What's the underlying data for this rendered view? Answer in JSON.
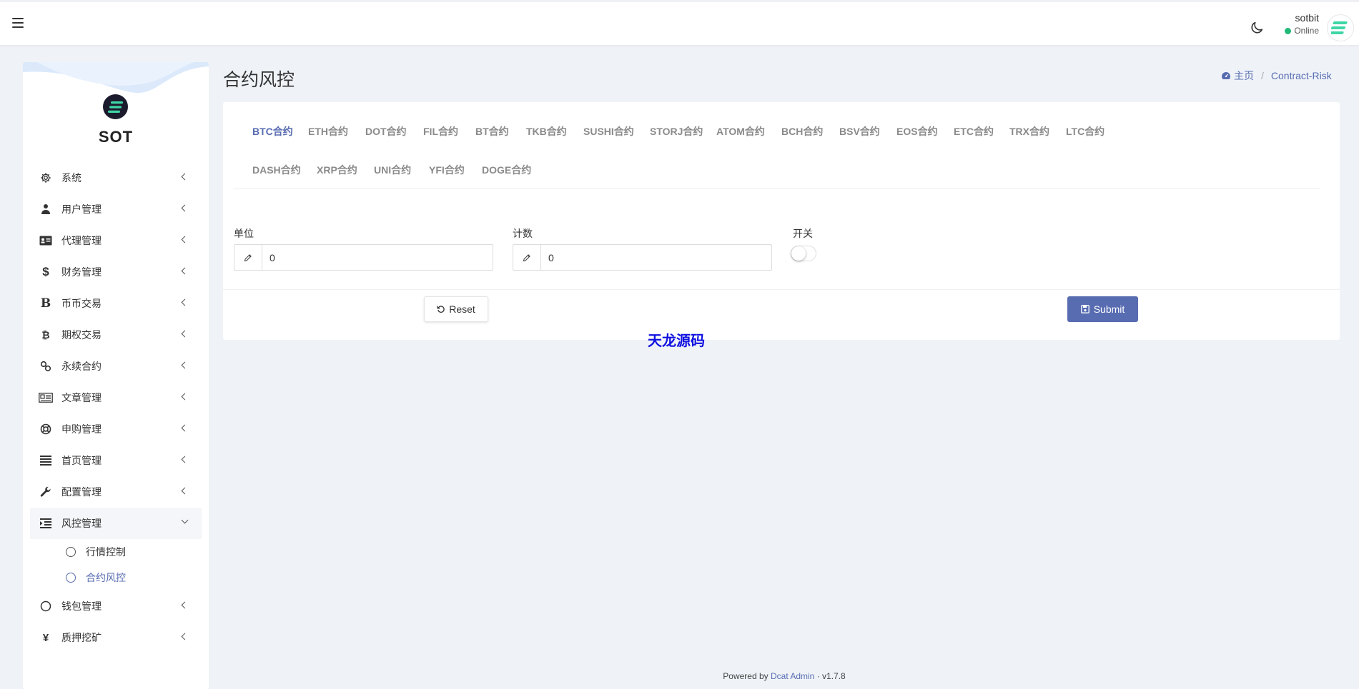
{
  "topbar": {
    "user_name": "sotbit",
    "user_status": "Online",
    "colors": {
      "online": "#21b978"
    }
  },
  "sidebar": {
    "logo_text": "SOT",
    "items": [
      {
        "label": "系统",
        "icon": "gear-icon"
      },
      {
        "label": "用户管理",
        "icon": "users-icon"
      },
      {
        "label": "代理管理",
        "icon": "id-card-icon"
      },
      {
        "label": "财务管理",
        "icon": "dollar-icon"
      },
      {
        "label": "币币交易",
        "icon": "bitcoin-b-icon"
      },
      {
        "label": "期权交易",
        "icon": "bitcoin-icon"
      },
      {
        "label": "永续合约",
        "icon": "link-icon"
      },
      {
        "label": "文章管理",
        "icon": "newspaper-icon"
      },
      {
        "label": "申购管理",
        "icon": "life-ring-icon"
      },
      {
        "label": "首页管理",
        "icon": "bars-icon"
      },
      {
        "label": "配置管理",
        "icon": "wrench-icon"
      },
      {
        "label": "风控管理",
        "icon": "indent-icon"
      },
      {
        "label": "钱包管理",
        "icon": "circle-icon"
      },
      {
        "label": "质押挖矿",
        "icon": "yen-icon"
      }
    ],
    "sub_items": [
      {
        "label": "行情控制"
      },
      {
        "label": "合约风控"
      }
    ]
  },
  "page": {
    "title": "合约风控",
    "breadcrumb": {
      "home": "主页",
      "current": "Contract-Risk"
    }
  },
  "tabs": [
    "BTC合约",
    "ETH合约",
    "DOT合约",
    "FIL合约",
    "BT合约",
    "TKB合约",
    "SUSHI合约",
    "STORJ合约",
    "ATOM合约",
    "BCH合约",
    "BSV合约",
    "EOS合约",
    "ETC合约",
    "TRX合约",
    "LTC合约",
    "DASH合约",
    "XRP合约",
    "UNI合约",
    "YFI合约",
    "DOGE合约"
  ],
  "form": {
    "unit_label": "单位",
    "unit_value": "0",
    "count_label": "计数",
    "count_value": "0",
    "switch_label": "开关",
    "reset_label": "Reset",
    "submit_label": "Submit"
  },
  "watermark": "天龙源码",
  "footer": {
    "powered_by": "Powered by",
    "link": "Dcat Admin",
    "separator": "·",
    "version": "v1.7.8"
  },
  "colors": {
    "accent": "#586cb1",
    "watermark": "#1010e0"
  }
}
